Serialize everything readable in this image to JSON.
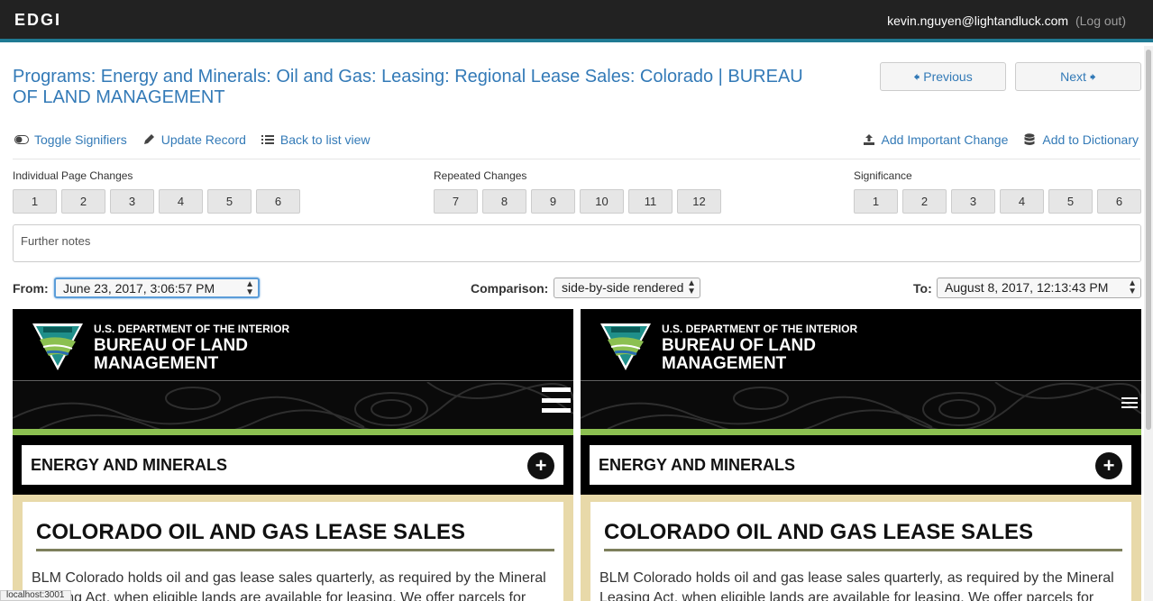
{
  "app": {
    "brand": "EDGI",
    "user_email": "kevin.nguyen@lightandluck.com",
    "logout_label": "(Log out)"
  },
  "page": {
    "title": "Programs: Energy and Minerals: Oil and Gas: Leasing: Regional Lease Sales: Colorado | BUREAU OF LAND MANAGEMENT",
    "previous_label": "Previous",
    "next_label": "Next"
  },
  "actions": {
    "toggle_signifiers": "Toggle Signifiers",
    "update_record": "Update Record",
    "back_to_list": "Back to list view",
    "add_important_change": "Add Important Change",
    "add_to_dictionary": "Add to Dictionary"
  },
  "groups": {
    "individual": {
      "label": "Individual Page Changes",
      "buttons": [
        "1",
        "2",
        "3",
        "4",
        "5",
        "6"
      ]
    },
    "repeated": {
      "label": "Repeated Changes",
      "buttons": [
        "7",
        "8",
        "9",
        "10",
        "11",
        "12"
      ]
    },
    "significance": {
      "label": "Significance",
      "buttons": [
        "1",
        "2",
        "3",
        "4",
        "5",
        "6"
      ]
    }
  },
  "notes": {
    "placeholder": "Further notes"
  },
  "compare": {
    "from_label": "From:",
    "from_value": "June 23, 2017, 3:06:57 PM",
    "comparison_label": "Comparison:",
    "comparison_value": "side-by-side rendered",
    "to_label": "To:",
    "to_value": "August 8, 2017, 12:13:43 PM"
  },
  "rendered_page": {
    "dept": "U.S. DEPARTMENT OF THE INTERIOR",
    "agency_line1": "BUREAU OF LAND",
    "agency_line2": "MANAGEMENT",
    "section": "ENERGY AND MINERALS",
    "heading": "COLORADO OIL AND GAS LEASE SALES",
    "body_left": "BLM Colorado holds oil and gas lease sales quarterly, as required by the Mineral Leasing Act, when eligible lands are available for leasing. We offer parcels for",
    "body_right": "BLM Colorado holds oil and gas lease sales quarterly, as required by the Mineral Leasing Act, when eligible lands are available for leasing. We offer parcels for"
  },
  "status_bar": "localhost:3001",
  "colors": {
    "link": "#337ab7",
    "topbar": "#222222",
    "accent": "#1f7a93",
    "green": "#8cc051"
  }
}
